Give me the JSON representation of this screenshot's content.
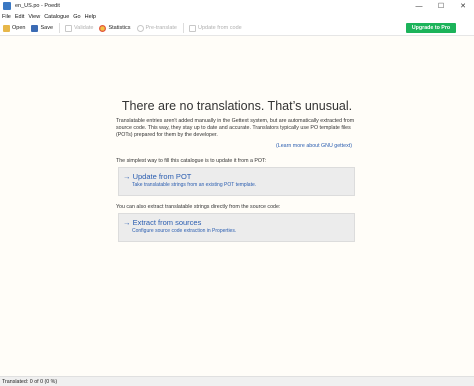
{
  "window": {
    "title": "en_US.po - Poedit",
    "controls": {
      "minimize": "—",
      "maximize": "☐",
      "close": "✕"
    }
  },
  "menu": [
    "File",
    "Edit",
    "View",
    "Catalogue",
    "Go",
    "Help"
  ],
  "toolbar": {
    "open": "Open",
    "save": "Save",
    "validate": "Validate",
    "statistics": "Statistics",
    "pretranslate": "Pre-translate",
    "update_from_code": "Update from code",
    "upgrade": "Upgrade to Pro"
  },
  "main": {
    "heading": "There are no translations. That’s unusual.",
    "description": "Translatable entries aren't added manually in the Gettext system, but are automatically extracted from source code. This way, they stay up to date and accurate. Translators typically use PO template files (POTs) prepared for them by the developer.",
    "learn_more": "(Learn more about GNU gettext)",
    "simplest": "The simplest way to fill this catalogue is to update it from a POT:",
    "update_from_pot": {
      "title": "→ Update from POT",
      "subtitle": "Take translatable strings from an existing POT template."
    },
    "also": "You can also extract translatable strings directly from the source code:",
    "extract_from_sources": {
      "title": "→ Extract from sources",
      "subtitle": "Configure source code extraction in Properties."
    }
  },
  "status": {
    "text": "Translated: 0 of 0 (0 %)"
  },
  "colors": {
    "accent": "#2a5db0",
    "upgrade_bg": "#1cb35a",
    "card_bg": "#ececec"
  }
}
